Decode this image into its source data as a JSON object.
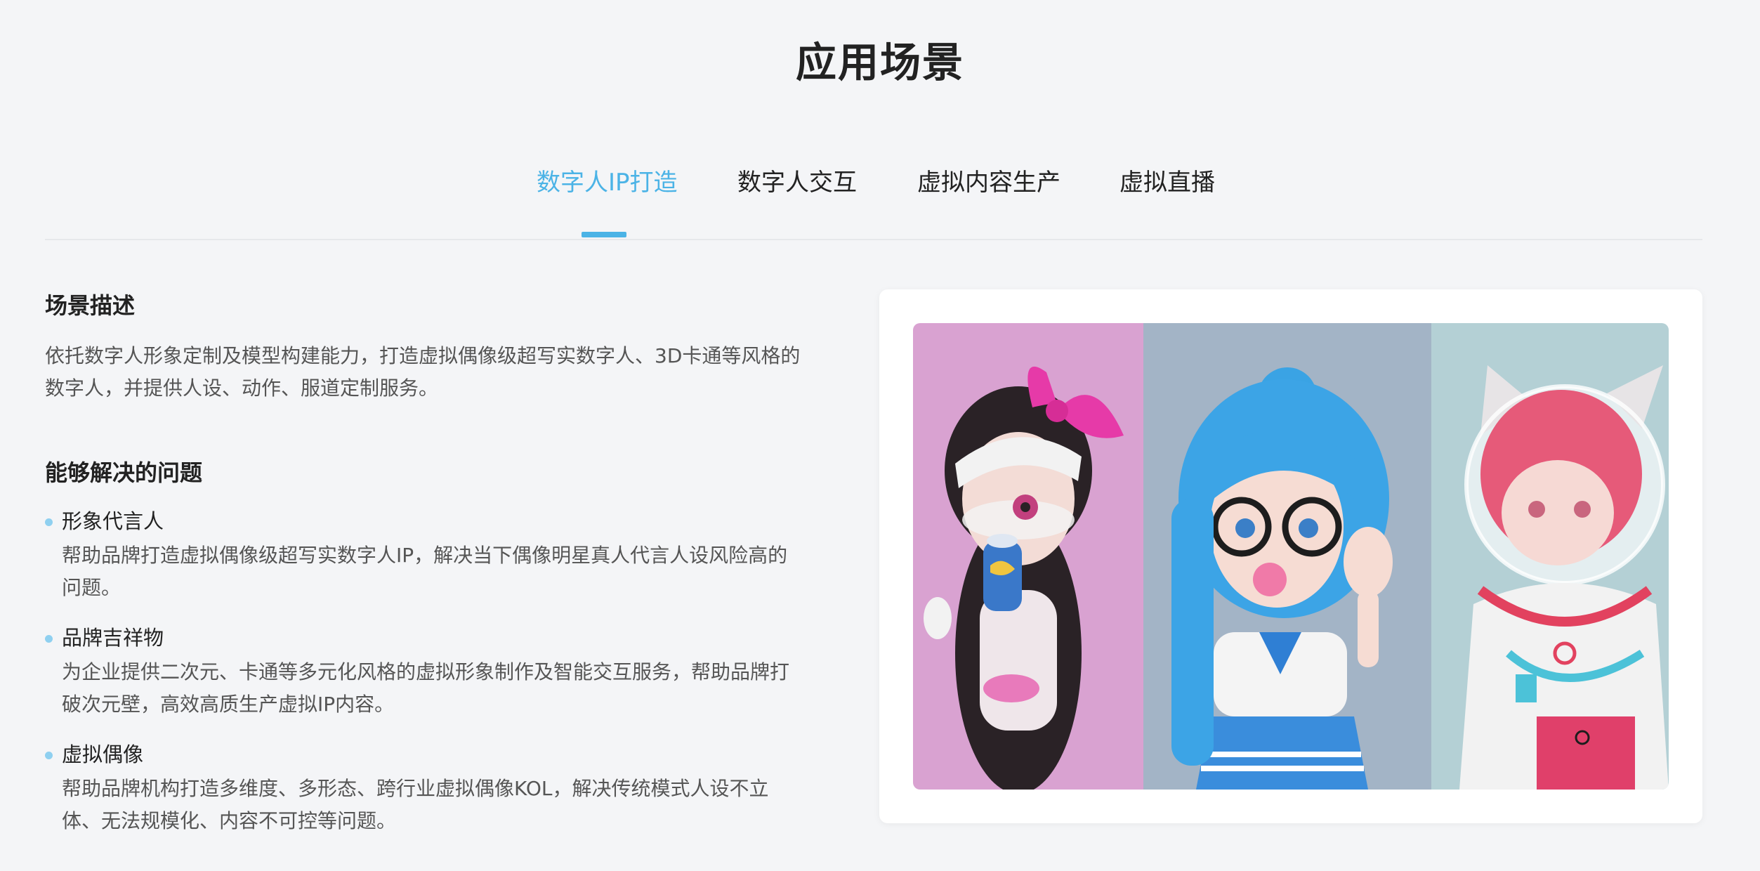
{
  "page": {
    "title": "应用场景"
  },
  "tabs": [
    {
      "label": "数字人IP打造",
      "active": true
    },
    {
      "label": "数字人交互",
      "active": false
    },
    {
      "label": "虚拟内容生产",
      "active": false
    },
    {
      "label": "虚拟直播",
      "active": false
    }
  ],
  "scene": {
    "heading": "场景描述",
    "description": "依托数字人形象定制及模型构建能力，打造虚拟偶像级超写实数字人、3D卡通等风格的\n数字人，并提供人设、动作、服道定制服务。"
  },
  "problems": {
    "heading": "能够解决的问题",
    "items": [
      {
        "title": "形象代言人",
        "text": "帮助品牌打造虚拟偶像级超写实数字人IP，解决当下偶像明星真人代言人设风险高的\n问题。"
      },
      {
        "title": "品牌吉祥物",
        "text": "为企业提供二次元、卡通等多元化风格的虚拟形象制作及智能交互服务，帮助品牌打\n破次元壁，高效高质生产虚拟IP内容。"
      },
      {
        "title": "虚拟偶像",
        "text": "帮助品牌机构打造多维度、多形态、跨行业虚拟偶像KOL，解决传统模式人设不立\n体、无法规模化、内容不可控等问题。"
      }
    ]
  },
  "colors": {
    "accent": "#4bb3e6",
    "background": "#f4f5f7"
  }
}
